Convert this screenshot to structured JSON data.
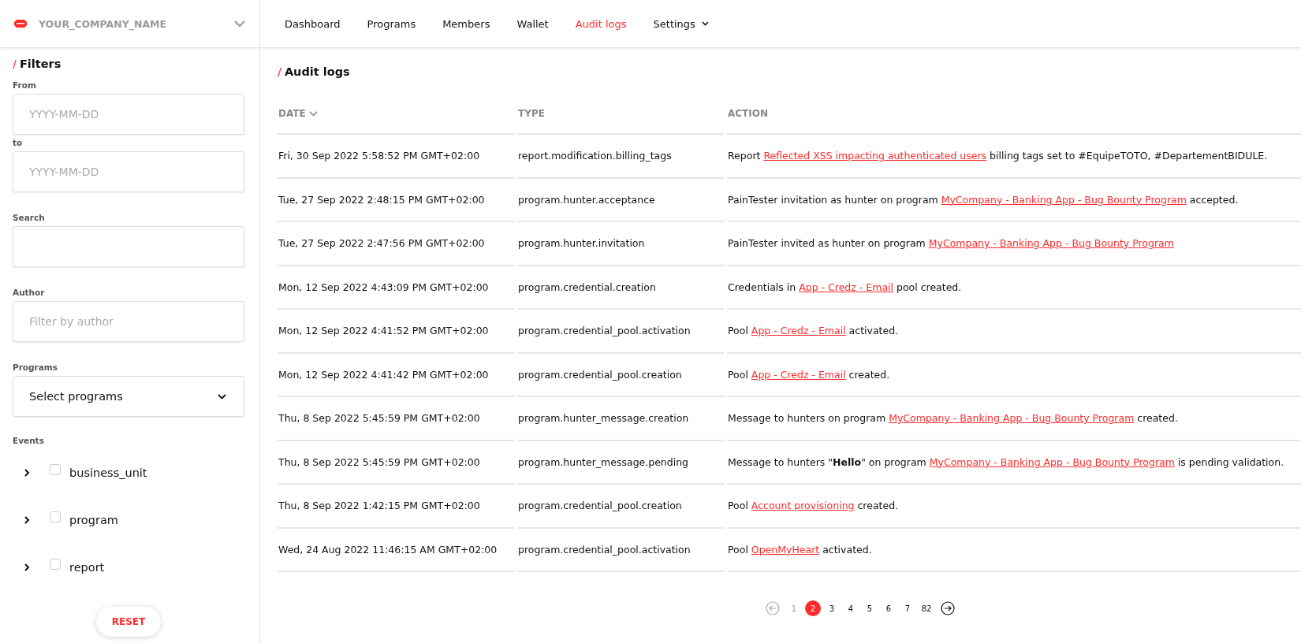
{
  "company": {
    "name": "YOUR_COMPANY_NAME"
  },
  "nav": [
    {
      "label": "Dashboard",
      "selected": false,
      "dropdown": false
    },
    {
      "label": "Programs",
      "selected": false,
      "dropdown": false
    },
    {
      "label": "Members",
      "selected": false,
      "dropdown": false
    },
    {
      "label": "Wallet",
      "selected": false,
      "dropdown": false
    },
    {
      "label": "Audit logs",
      "selected": true,
      "dropdown": false
    },
    {
      "label": "Settings",
      "selected": false,
      "dropdown": true
    }
  ],
  "filters": {
    "slash": "/",
    "title": "Filters",
    "fields": [
      {
        "kind": "text",
        "label": "From",
        "placeholder": "YYYY-MM-DD"
      },
      {
        "kind": "text",
        "label": "to",
        "placeholder": "YYYY-MM-DD"
      },
      {
        "kind": "text",
        "label": "Search"
      },
      {
        "kind": "text",
        "label": "Author",
        "placeholder": "Filter by author"
      },
      {
        "kind": "select",
        "label": "Programs",
        "value": "Select programs"
      }
    ],
    "events_label": "Events",
    "events": [
      {
        "label": "business_unit",
        "checked": false,
        "expanded": false
      },
      {
        "label": "program",
        "checked": false,
        "expanded": false
      },
      {
        "label": "report",
        "checked": false,
        "expanded": false
      }
    ],
    "reset": "RESET"
  },
  "audit": {
    "slash": "/",
    "title": "Audit logs",
    "columns": [
      {
        "label": "DATE",
        "sorted": true
      },
      {
        "label": "TYPE",
        "sorted": false
      },
      {
        "label": "ACTION",
        "sorted": false
      }
    ],
    "rows": [
      {
        "date": "Fri, 30 Sep 2022 5:58:52 PM GMT+02:00",
        "type": "report.modification.billing_tags",
        "action": [
          {
            "kind": "text",
            "text": "Report "
          },
          {
            "kind": "link",
            "text": "Reflected XSS impacting authenticated users"
          },
          {
            "kind": "text",
            "text": " billing tags set to #EquipeTOTO, #DepartementBIDULE."
          }
        ]
      },
      {
        "date": "Tue, 27 Sep 2022 2:48:15 PM GMT+02:00",
        "type": "program.hunter.acceptance",
        "action": [
          {
            "kind": "text",
            "text": "PainTester invitation as hunter on program "
          },
          {
            "kind": "link",
            "text": "MyCompany - Banking App - Bug Bounty Program"
          },
          {
            "kind": "text",
            "text": " accepted."
          }
        ]
      },
      {
        "date": "Tue, 27 Sep 2022 2:47:56 PM GMT+02:00",
        "type": "program.hunter.invitation",
        "action": [
          {
            "kind": "text",
            "text": "PainTester invited as hunter on program "
          },
          {
            "kind": "link",
            "text": "MyCompany - Banking App - Bug Bounty Program"
          }
        ]
      },
      {
        "date": "Mon, 12 Sep 2022 4:43:09 PM GMT+02:00",
        "type": "program.credential.creation",
        "action": [
          {
            "kind": "text",
            "text": "Credentials in "
          },
          {
            "kind": "link",
            "text": "App - Credz - Email"
          },
          {
            "kind": "text",
            "text": " pool created."
          }
        ]
      },
      {
        "date": "Mon, 12 Sep 2022 4:41:52 PM GMT+02:00",
        "type": "program.credential_pool.activation",
        "action": [
          {
            "kind": "text",
            "text": "Pool "
          },
          {
            "kind": "link",
            "text": "App - Credz - Email"
          },
          {
            "kind": "text",
            "text": " activated."
          }
        ]
      },
      {
        "date": "Mon, 12 Sep 2022 4:41:42 PM GMT+02:00",
        "type": "program.credential_pool.creation",
        "action": [
          {
            "kind": "text",
            "text": "Pool "
          },
          {
            "kind": "link",
            "text": "App - Credz - Email"
          },
          {
            "kind": "text",
            "text": " created."
          }
        ]
      },
      {
        "date": "Thu, 8 Sep 2022 5:45:59 PM GMT+02:00",
        "type": "program.hunter_message.creation",
        "action": [
          {
            "kind": "text",
            "text": "Message to hunters on program "
          },
          {
            "kind": "link",
            "text": "MyCompany - Banking App - Bug Bounty Program"
          },
          {
            "kind": "text",
            "text": " created."
          }
        ]
      },
      {
        "date": "Thu, 8 Sep 2022 5:45:59 PM GMT+02:00",
        "type": "program.hunter_message.pending",
        "action": [
          {
            "kind": "text",
            "text": "Message to hunters \"**Hello**\" on program "
          },
          {
            "kind": "link",
            "text": "MyCompany - Banking App - Bug Bounty Program"
          },
          {
            "kind": "text",
            "text": " is pending validation."
          }
        ]
      },
      {
        "date": "Thu, 8 Sep 2022 1:42:15 PM GMT+02:00",
        "type": "program.credential_pool.creation",
        "action": [
          {
            "kind": "text",
            "text": "Pool "
          },
          {
            "kind": "link",
            "text": "Account provisioning"
          },
          {
            "kind": "text",
            "text": " created."
          }
        ]
      },
      {
        "date": "Wed, 24 Aug 2022 11:46:15 AM GMT+02:00",
        "type": "program.credential_pool.activation",
        "action": [
          {
            "kind": "text",
            "text": "Pool "
          },
          {
            "kind": "link",
            "text": "OpenMyHeart"
          },
          {
            "kind": "text",
            "text": " activated."
          }
        ]
      }
    ]
  },
  "pagination": {
    "prev_disabled": true,
    "next_disabled": false,
    "pages": [
      {
        "label": "1",
        "selected": false
      },
      {
        "label": "2",
        "selected": true
      },
      {
        "label": "3",
        "selected": false
      },
      {
        "label": "4",
        "selected": false
      },
      {
        "label": "5",
        "selected": false
      },
      {
        "label": "6",
        "selected": false
      },
      {
        "label": "7",
        "selected": false
      },
      {
        "label": "82",
        "selected": false
      }
    ]
  }
}
